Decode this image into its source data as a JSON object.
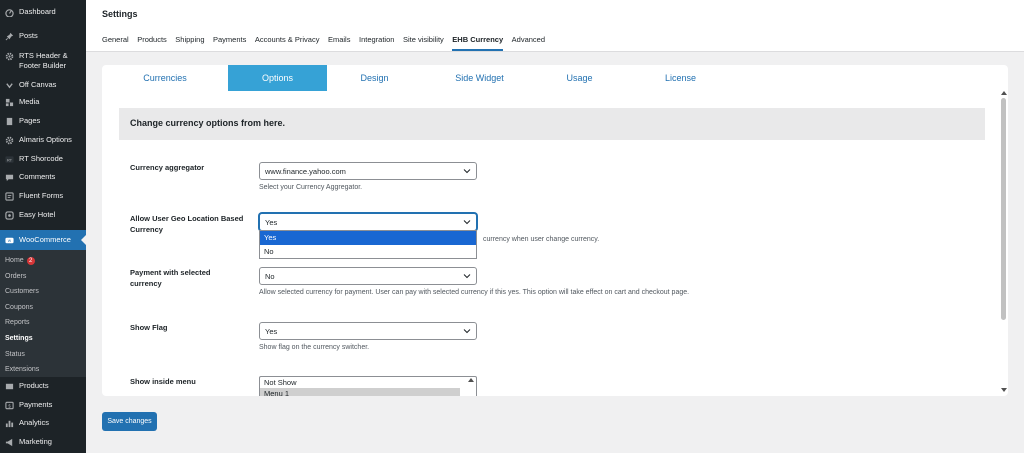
{
  "sidebar": {
    "items": [
      {
        "label": "Dashboard",
        "icon": "dashboard-icon"
      },
      {
        "label": "Posts",
        "icon": "pin-icon"
      },
      {
        "label": "RTS Header & Footer Builder",
        "icon": "gear-icon"
      },
      {
        "label": "Off Canvas",
        "icon": "chevron-down-icon"
      },
      {
        "label": "Media",
        "icon": "media-icon"
      },
      {
        "label": "Pages",
        "icon": "page-icon"
      },
      {
        "label": "Almaris Options",
        "icon": "gear-icon"
      },
      {
        "label": "RT Shorcode",
        "icon": "rt-icon"
      },
      {
        "label": "Comments",
        "icon": "comment-icon"
      },
      {
        "label": "Fluent Forms",
        "icon": "form-icon"
      },
      {
        "label": "Easy Hotel",
        "icon": "hotel-icon"
      },
      {
        "label": "WooCommerce",
        "icon": "woo-icon"
      }
    ],
    "submenu": [
      {
        "label": "Home",
        "badge": "2"
      },
      {
        "label": "Orders"
      },
      {
        "label": "Customers"
      },
      {
        "label": "Coupons"
      },
      {
        "label": "Reports"
      },
      {
        "label": "Settings"
      },
      {
        "label": "Status"
      },
      {
        "label": "Extensions"
      }
    ],
    "bottom_items": [
      {
        "label": "Products",
        "icon": "products-icon"
      },
      {
        "label": "Payments",
        "icon": "payments-icon"
      },
      {
        "label": "Analytics",
        "icon": "analytics-icon"
      },
      {
        "label": "Marketing",
        "icon": "megaphone-icon"
      }
    ]
  },
  "header": {
    "title": "Settings",
    "tabs": [
      "General",
      "Products",
      "Shipping",
      "Payments",
      "Accounts & Privacy",
      "Emails",
      "Integration",
      "Site visibility",
      "EHB Currency",
      "Advanced"
    ],
    "current_tab": "EHB Currency"
  },
  "plugin_tabs": [
    "Currencies",
    "Options",
    "Design",
    "Side Widget",
    "Usage",
    "License"
  ],
  "plugin_active_tab": "Options",
  "notice": "Change currency options from here.",
  "rows": {
    "aggregator": {
      "label": "Currency aggregator",
      "value": "www.finance.yahoo.com",
      "desc": "Select your Currency Aggregator."
    },
    "geo": {
      "label": "Allow User Geo Location Based Currency",
      "value": "Yes",
      "desc": "currency when user change currency.",
      "options": [
        "Yes",
        "No"
      ]
    },
    "payment": {
      "label": "Payment with selected currency",
      "value": "No",
      "desc": "Allow selected currency for payment. User can pay with selected currency if this yes. This option will take effect on cart and checkout page."
    },
    "flag": {
      "label": "Show Flag",
      "value": "Yes",
      "desc": "Show flag on the currency switcher."
    },
    "menu": {
      "label": "Show inside menu",
      "options": [
        "Not Show",
        "Menu 1"
      ]
    }
  },
  "save_label": "Save changes",
  "colors": {
    "sidebar_bg": "#1d2327",
    "accent": "#2271b1",
    "active_tab": "#36a2d6",
    "highlight": "#1967d2"
  }
}
